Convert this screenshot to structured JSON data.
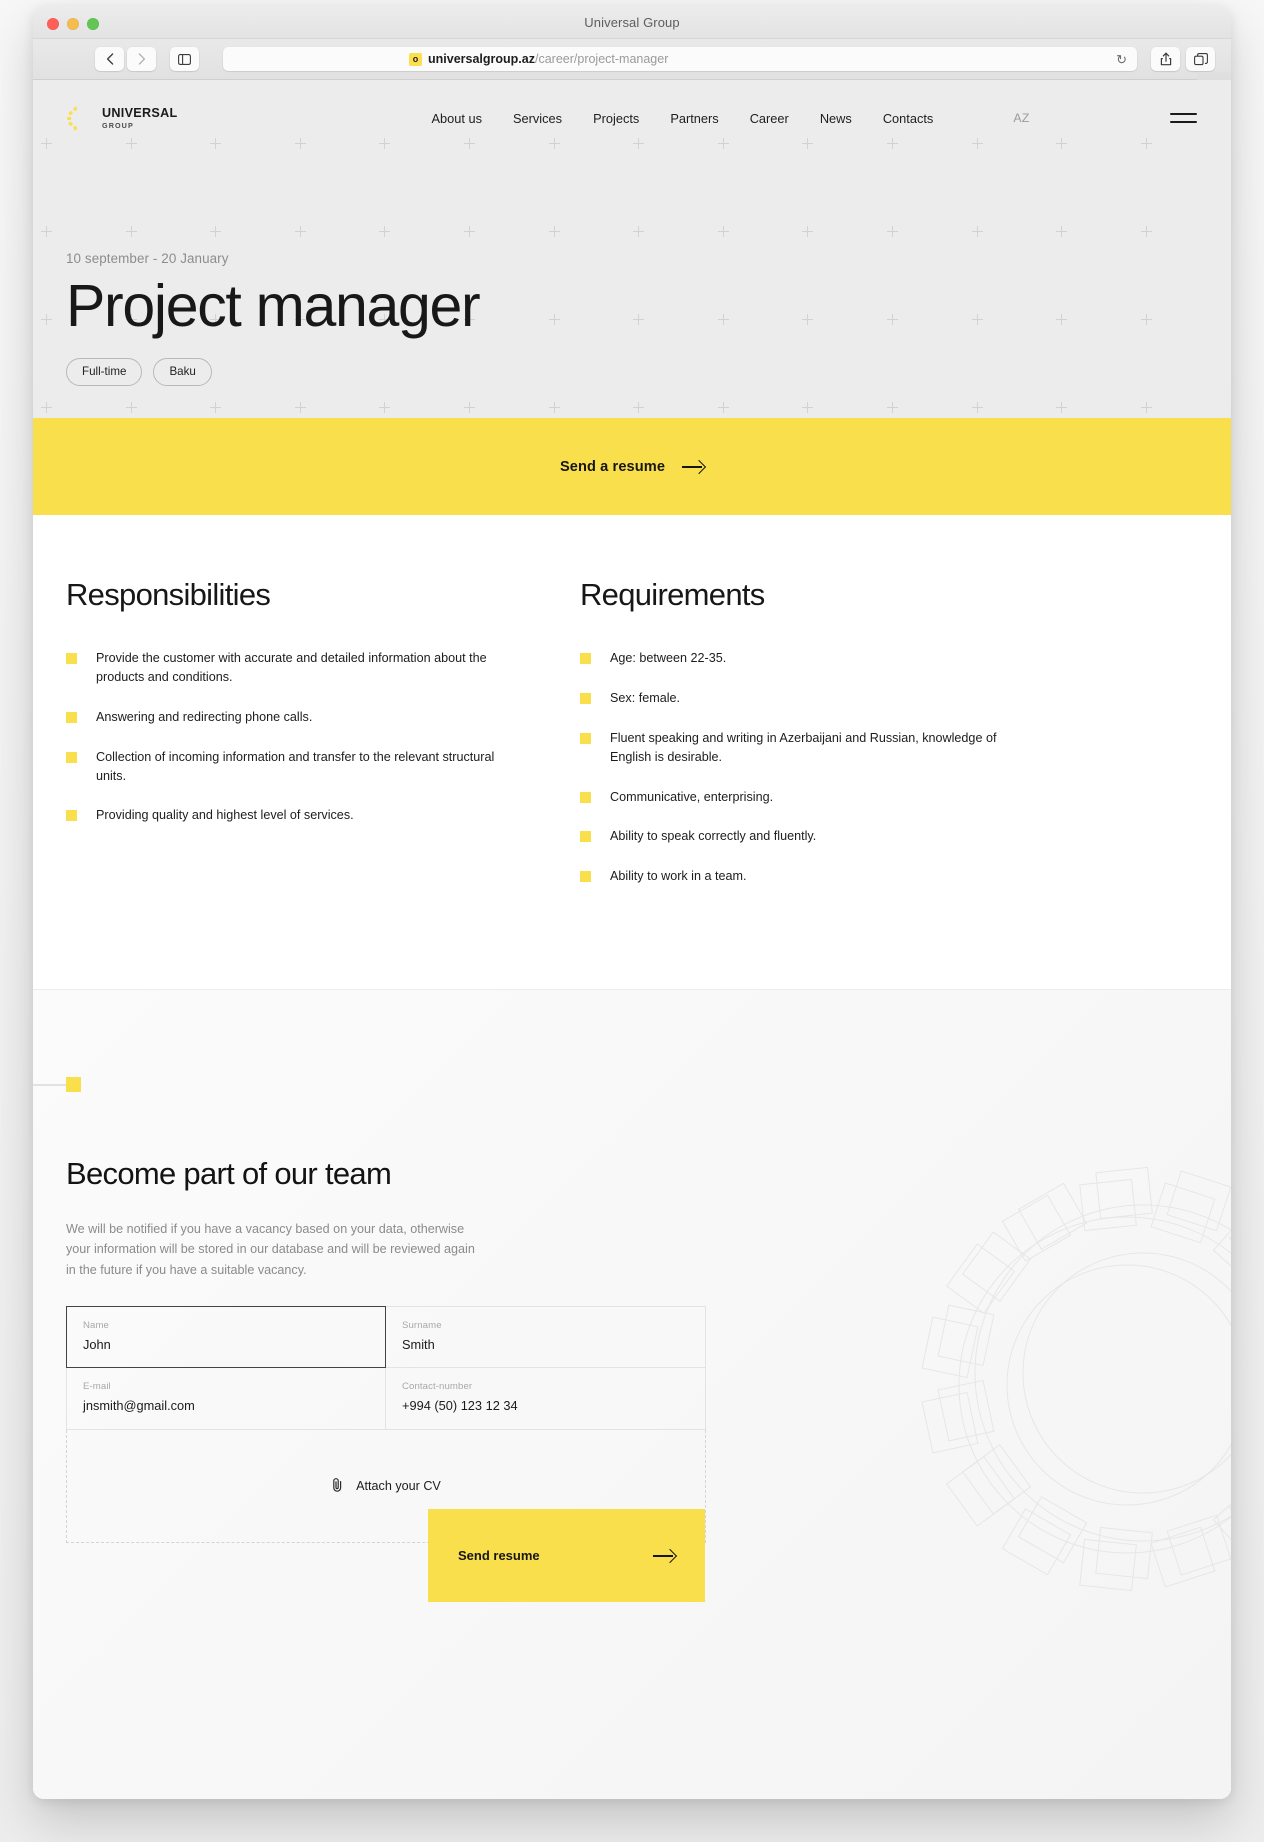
{
  "browser": {
    "window_title": "Universal Group",
    "url_domain": "universalgroup.az",
    "url_path": "/career/project-manager",
    "favicon_letter": "o",
    "back_icon": "chevron-left-icon",
    "forward_icon": "chevron-right-icon",
    "sidebar_icon": "sidebar-toggle-icon",
    "reload_icon": "↻",
    "share_icon": "share-icon",
    "tabs_icon": "tabs-overview-icon",
    "newtab_icon": "+"
  },
  "site_nav": {
    "logo_line1": "UNIVERSAL",
    "logo_line2": "GROUP",
    "links": [
      {
        "label": "About us"
      },
      {
        "label": "Services"
      },
      {
        "label": "Projects"
      },
      {
        "label": "Partners"
      },
      {
        "label": "Career"
      },
      {
        "label": "News"
      },
      {
        "label": "Contacts"
      }
    ],
    "language": "AZ"
  },
  "hero": {
    "date_range": "10 september - 20 January",
    "title": "Project manager",
    "chips": [
      "Full-time",
      "Baku"
    ]
  },
  "band": {
    "label": "Send a resume",
    "arrow": "arrow-right-icon"
  },
  "responsibilities": {
    "heading": "Responsibilities",
    "items": [
      "Provide the customer with accurate and detailed information about the products and conditions.",
      "Answering and redirecting phone calls.",
      "Collection of incoming information and transfer to the relevant structural units.",
      "Providing quality and highest level of services."
    ]
  },
  "requirements": {
    "heading": "Requirements",
    "items": [
      "Age: between 22-35.",
      "Sex: female.",
      "Fluent speaking and writing in Azerbaijani and Russian, knowledge of English is desirable.",
      "Communicative, enterprising.",
      "Ability to speak correctly and fluently.",
      "Ability to work in a team."
    ]
  },
  "team": {
    "heading": "Become part of our team",
    "description": "We will be notified if you have a vacancy based on your data, otherwise your information will be stored in our database and will be reviewed again in the future if you have a suitable vacancy.",
    "form": {
      "name": {
        "label": "Name",
        "value": "John"
      },
      "surname": {
        "label": "Surname",
        "value": "Smith"
      },
      "email": {
        "label": "E-mail",
        "value": "jnsmith@gmail.com"
      },
      "contact": {
        "label": "Contact-number",
        "value": "+994 (50) 123 12 34"
      },
      "attach": {
        "label": "Attach your CV",
        "icon": "paperclip-icon"
      },
      "submit": {
        "label": "Send resume",
        "arrow": "arrow-right-icon"
      }
    }
  },
  "colors": {
    "accent_yellow": "#fadf4d",
    "hero_bg": "#ececec",
    "text_dark": "#1b1b1b",
    "muted": "#8d8d8d"
  }
}
